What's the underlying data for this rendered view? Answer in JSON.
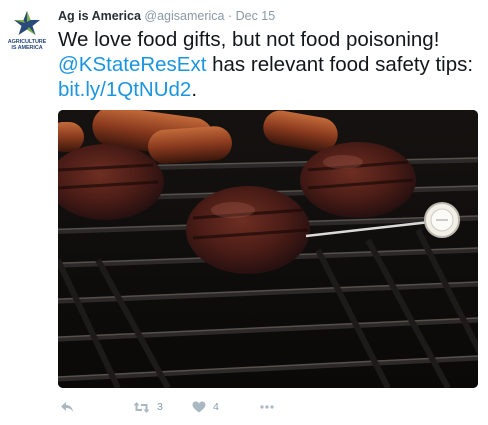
{
  "tweet": {
    "author": {
      "name": "Ag is America",
      "handle": "@agisamerica",
      "avatar_text": "AGRICULTURE IS AMERICA"
    },
    "separator": "·",
    "timestamp": "Dec 15",
    "text_part1": "We love food gifts, but not food poisoning! ",
    "mention": "@KStateResExt",
    "text_part2": " has relevant food safety tips: ",
    "link": "bit.ly/1QtNUd2",
    "text_end": ".",
    "media": {
      "icon": "photo-grill-burgers"
    },
    "actions": {
      "retweet_count": "3",
      "like_count": "4"
    }
  },
  "colors": {
    "link": "#1b95e0",
    "meta": "#8899a6",
    "action_icon": "#aab8c2"
  }
}
